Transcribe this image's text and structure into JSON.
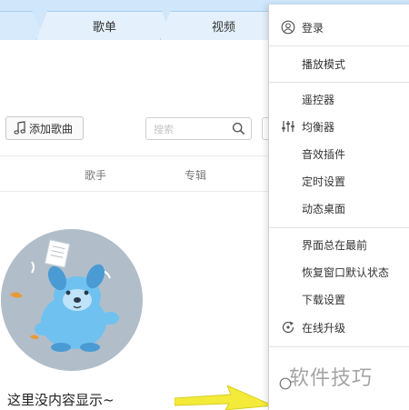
{
  "tabs": [
    {
      "label": ""
    },
    {
      "label": "歌单"
    },
    {
      "label": "视频"
    }
  ],
  "toolbar": {
    "add_song_label": "添加歌曲",
    "search_placeholder": "搜索"
  },
  "columns": {
    "artist": "歌手",
    "album": "专辑"
  },
  "empty_state": {
    "message": "这里没内容显示~"
  },
  "menu": {
    "items": [
      {
        "label": "登录",
        "icon": "user-icon"
      },
      {
        "label": "播放模式",
        "icon": ""
      },
      {
        "label": "遥控器",
        "icon": ""
      },
      {
        "label": "均衡器",
        "icon": "equalizer-icon"
      },
      {
        "label": "音效插件",
        "icon": ""
      },
      {
        "label": "定时设置",
        "icon": ""
      },
      {
        "label": "动态桌面",
        "icon": ""
      },
      {
        "label": "界面总在最前",
        "icon": ""
      },
      {
        "label": "恢复窗口默认状态",
        "icon": ""
      },
      {
        "label": "下载设置",
        "icon": ""
      },
      {
        "label": "在线升级",
        "icon": "upgrade-icon"
      }
    ]
  },
  "watermark": "软件技巧",
  "colors": {
    "tab_bar": "#cfe6fb",
    "accent_blue": "#5aa9e6",
    "highlight_red": "#d9261c",
    "arrow_yellow": "#f3ea3a"
  }
}
